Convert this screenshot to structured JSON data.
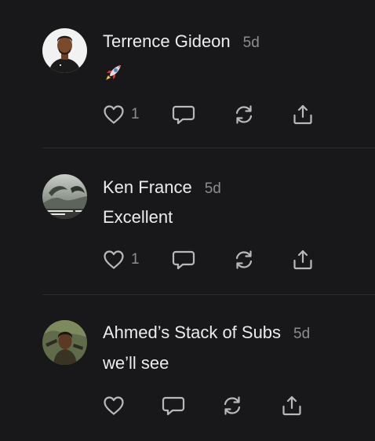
{
  "comments": [
    {
      "author": "Terrence Gideon",
      "time": "5d",
      "text": "",
      "emoji": "rocket",
      "like_count": "1"
    },
    {
      "author": "Ken France",
      "time": "5d",
      "text": "Excellent",
      "like_count": "1"
    },
    {
      "author": "Ahmed’s Stack of Subs",
      "time": "5d",
      "text": "we’ll see",
      "like_count": ""
    }
  ],
  "colors": {
    "background": "#18181a",
    "text": "#ececec",
    "muted": "#8d8d91",
    "icon": "#b9b9bd"
  },
  "icons": [
    "heart-icon",
    "comment-bubble-icon",
    "restack-icon",
    "share-icon",
    "rocket-emoji"
  ]
}
